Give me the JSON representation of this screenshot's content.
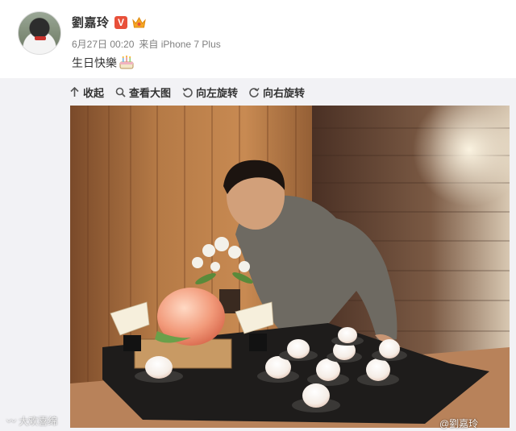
{
  "post": {
    "author": "劉嘉玲",
    "verified_badge": "V",
    "timestamp": "6月27日 00:20",
    "source": "来自 iPhone 7 Plus",
    "text": "生日快樂"
  },
  "toolbar": {
    "collapse": "收起",
    "view_large": "查看大图",
    "rotate_left": "向左旋转",
    "rotate_right": "向右旋转"
  },
  "watermarks": {
    "left": "大欢喜绵",
    "right": "@劉嘉玲"
  },
  "icons": [
    "avatar",
    "verified-v-icon",
    "crown-icon",
    "cake-emoji-icon",
    "collapse-arrow-icon",
    "magnifier-icon",
    "rotate-left-icon",
    "rotate-right-icon",
    "weibo-logo-icon"
  ]
}
